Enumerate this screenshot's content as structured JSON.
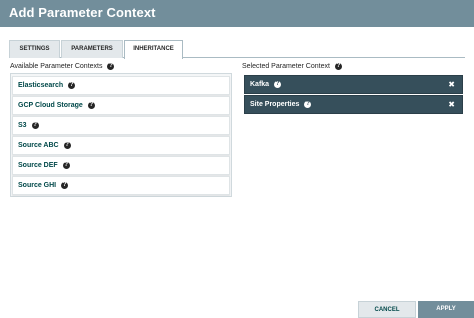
{
  "dialog": {
    "title": "Add Parameter Context"
  },
  "tabs": [
    {
      "label": "SETTINGS"
    },
    {
      "label": "PARAMETERS"
    },
    {
      "label": "INHERITANCE"
    }
  ],
  "available": {
    "label": "Available Parameter Contexts",
    "items": [
      {
        "label": "Elasticsearch"
      },
      {
        "label": "GCP Cloud Storage"
      },
      {
        "label": "S3"
      },
      {
        "label": "Source ABC"
      },
      {
        "label": "Source DEF"
      },
      {
        "label": "Source GHI"
      }
    ]
  },
  "selected": {
    "label": "Selected Parameter Context",
    "items": [
      {
        "label": "Kafka",
        "remove": "✖"
      },
      {
        "label": "Site Properties",
        "remove": "✖"
      }
    ]
  },
  "icons": {
    "help": "?"
  },
  "buttons": {
    "cancel": "CANCEL",
    "apply": "APPLY"
  },
  "colors": {
    "header": "#728e9b",
    "selected_item": "#364f5b",
    "accent_text": "#004849"
  }
}
